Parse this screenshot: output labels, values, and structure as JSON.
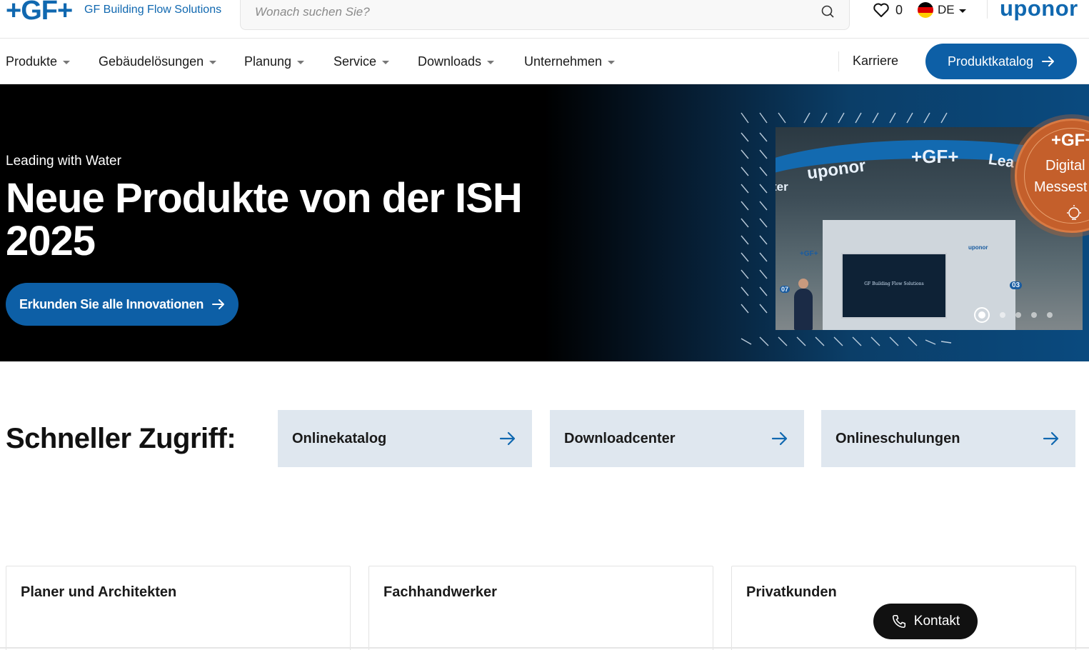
{
  "header": {
    "logo_text": "+GF+",
    "tagline": "GF Building Flow Solutions",
    "search_placeholder": "Wonach suchen Sie?",
    "wishlist_count": "0",
    "language": "DE",
    "brand_logo_text": "uponor"
  },
  "nav": {
    "items": [
      {
        "label": "Produkte"
      },
      {
        "label": "Gebäudelösungen"
      },
      {
        "label": "Planung"
      },
      {
        "label": "Service"
      },
      {
        "label": "Downloads"
      },
      {
        "label": "Unternehmen"
      }
    ],
    "karriere_label": "Karriere",
    "catalog_button_label": "Produktkatalog"
  },
  "hero": {
    "eyebrow": "Leading with Water",
    "title": "Neue Produkte von der ISH 2025",
    "cta_label": "Erkunden Sie alle Innovationen",
    "image_texts": {
      "brand": "uponor",
      "gf": "+GF+",
      "lea": "Lea",
      "ter": "ter",
      "screen": "GF Building Flow Solutions",
      "booth_gf": "+GF+",
      "booth_uponor": "uponor",
      "num1": "07",
      "num2": "03"
    },
    "badge": {
      "line1": "+GF+",
      "line2": "Digital",
      "line3": "Messest"
    },
    "slide_count": 5,
    "active_slide": 1
  },
  "quick_access": {
    "title": "Schneller Zugriff:",
    "cards": [
      {
        "label": "Onlinekatalog"
      },
      {
        "label": "Downloadcenter"
      },
      {
        "label": "Onlineschulungen"
      }
    ]
  },
  "audiences": [
    {
      "label": "Planer und Architekten"
    },
    {
      "label": "Fachhandwerker"
    },
    {
      "label": "Privatkunden"
    }
  ],
  "contact": {
    "label": "Kontakt"
  },
  "colors": {
    "brand_blue": "#0d5fa6",
    "logo_blue": "#1068b0",
    "quick_card_bg": "#dfe7ef",
    "badge_orange": "#c45f2b",
    "contact_bg": "#111111"
  }
}
